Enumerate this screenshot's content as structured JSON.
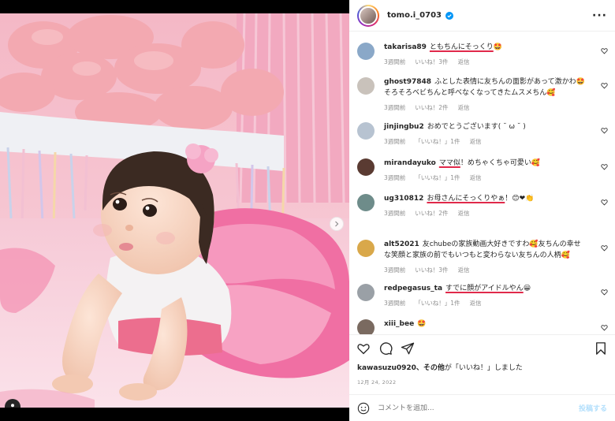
{
  "post": {
    "username": "tomo.i_0703",
    "verified": true,
    "more_icon": "more-horizontal-icon"
  },
  "comments": [
    {
      "user": "takarisa89",
      "text": "ともちんにそっくり🤩",
      "highlight": "ともちんにそっくり",
      "time": "3週間前",
      "likes": "いいね！3件",
      "reply": "返信",
      "avatar_color": "#8aa8c8"
    },
    {
      "user": "ghost97848",
      "text": "ふとした表情に友ちんの面影があって激かわ🤩そろそろベビちんと呼べなくなってきたムスメちん🥰",
      "highlight": "",
      "time": "3週間前",
      "likes": "いいね！2件",
      "reply": "返信",
      "avatar_color": "#c9c2bb"
    },
    {
      "user": "jinjingbu2",
      "text": "おめでとうございます( ˘ ω ˘ )",
      "highlight": "",
      "time": "3週間前",
      "likes": "「いいね！」1件",
      "reply": "返信",
      "avatar_color": "#b7c3d1"
    },
    {
      "user": "mirandayuko",
      "text": "ママ似！めちゃくちゃ可愛い🥰",
      "highlight": "ママ似",
      "time": "3週間前",
      "likes": "「いいね！」1件",
      "reply": "返信",
      "avatar_color": "#5a3b32"
    },
    {
      "user": "ug310812",
      "text": "お母さんにそっくりやぁ！😊❤👏",
      "highlight": "お母さんにそっくりやぁ",
      "time": "3週間前",
      "likes": "いいね！2件",
      "reply": "返信",
      "avatar_color": "#6e8c8a"
    },
    {
      "user": "alt52021",
      "text": "友chubeの家族動画大好きですわ🥰友ちんの幸せな笑顔と家族の前でもいつもと変わらない友ちんの人柄🥰",
      "highlight": "",
      "time": "3週間前",
      "likes": "いいね！3件",
      "reply": "返信",
      "avatar_color": "#d9a84a"
    },
    {
      "user": "redpegasus_ta",
      "text": "すでに顔がアイドルやん😀",
      "highlight": "すでに顔がアイドルやん",
      "time": "3週間前",
      "likes": "「いいね！」1件",
      "reply": "返信",
      "avatar_color": "#9aa0a6"
    },
    {
      "user": "xiii_bee",
      "text": "🤩",
      "highlight": "",
      "time": "",
      "likes": "",
      "reply": "",
      "avatar_color": "#7a6a60"
    }
  ],
  "actions": {
    "like_icon": "heart-icon",
    "comment_icon": "comment-icon",
    "share_icon": "share-icon",
    "save_icon": "bookmark-icon"
  },
  "likes_line": {
    "user": "kawasuzu0920",
    "rest": "、その他",
    "suffix": "が「いいね！」しました"
  },
  "date": "12月 24, 2022",
  "add_comment": {
    "placeholder": "コメントを追加...",
    "post_label": "投稿する"
  },
  "media": {
    "next_icon": "chevron-right-icon",
    "tag_icon": "user-tag-icon"
  },
  "colors": {
    "highlight": "#e0294a",
    "verified": "#0095f6",
    "link_disabled": "#b2dffc"
  }
}
